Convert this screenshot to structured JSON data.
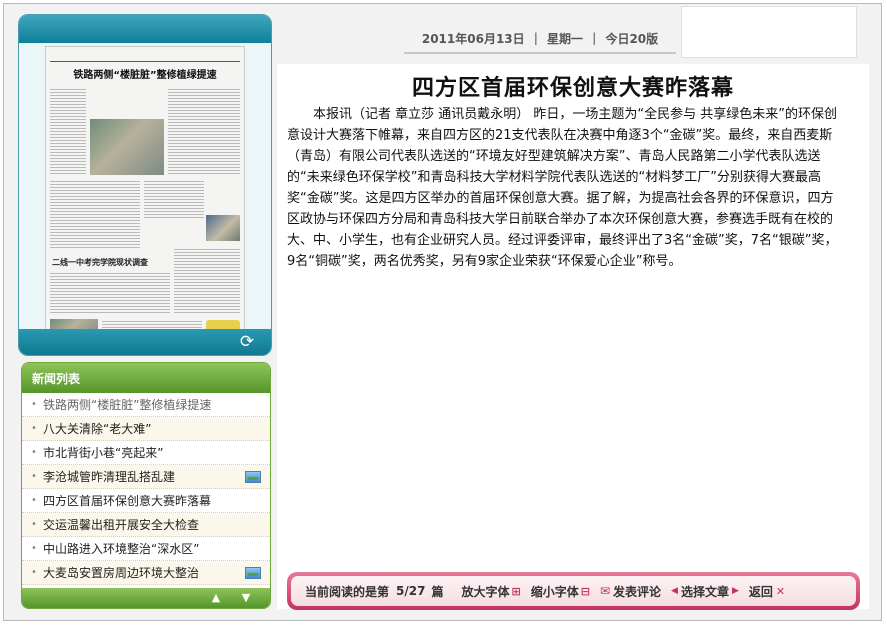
{
  "newspaper_preview": {
    "headline": "铁路两侧“楼脏脏”整修植绿提速",
    "subline": "",
    "big_caption": "二线一中考完学院现状调查",
    "image_alt": ""
  },
  "news_list": {
    "title": "新闻列表",
    "items": [
      {
        "label": "铁路两侧“楼脏脏”整修植绿提速",
        "has_image": false,
        "current": true
      },
      {
        "label": "八大关清除“老大难”",
        "has_image": false,
        "current": false
      },
      {
        "label": "市北背街小巷“亮起来”",
        "has_image": false,
        "current": false
      },
      {
        "label": "李沧城管昨清理乱搭乱建",
        "has_image": true,
        "current": false
      },
      {
        "label": "四方区首届环保创意大赛昨落幕",
        "has_image": false,
        "current": false
      },
      {
        "label": "交运温馨出租开展安全大检查",
        "has_image": false,
        "current": false
      },
      {
        "label": "中山路进入环境整治“深水区”",
        "has_image": false,
        "current": false
      },
      {
        "label": "大麦岛安置房周边环境大整治",
        "has_image": true,
        "current": false
      }
    ]
  },
  "date_bar": {
    "date": "2011年06月13日",
    "weekday": "星期一",
    "edition": "今日20版",
    "separator": "|"
  },
  "article": {
    "title": "四方区首届环保创意大赛昨落幕",
    "body": "本报讯（记者 章立莎 通讯员戴永明） 昨日，一场主题为“全民参与 共享绿色未来”的环保创意设计大赛落下帷幕，来自四方区的21支代表队在决赛中角逐3个“金碳”奖。最终，来自西麦斯（青岛）有限公司代表队选送的“环境友好型建筑解决方案”、青岛人民路第二小学代表队选送的“未来绿色环保学校”和青岛科技大学材料学院代表队选送的“材料梦工厂”分别获得大赛最高奖“金碳”奖。这是四方区举办的首届环保创意大赛。据了解，为提高社会各界的环保意识，四方区政协与环保四方分局和青岛科技大学日前联合举办了本次环保创意大赛，参赛选手既有在校的大、中、小学生，也有企业研究人员。经过评委评审，最终评出了3名“金碳”奖，7名“银碳”奖，9名“铜碳”奖，两名优秀奖，另有9家企业荣获“环保爱心企业”称号。"
  },
  "reading_bar": {
    "current_label": "当前阅读的是第",
    "current_value": "5/27",
    "current_unit": "篇",
    "enlarge": "放大字体",
    "shrink": "缩小字体",
    "comment": "发表评论",
    "select": "选择文章",
    "back": "返回"
  },
  "colors": {
    "teal": "#0f7f99",
    "green": "#55952a",
    "pink": "#c4325e"
  },
  "icons": [
    "refresh-icon",
    "image-icon",
    "arrow-up-icon",
    "arrow-down-icon",
    "mail-icon",
    "close-icon"
  ]
}
